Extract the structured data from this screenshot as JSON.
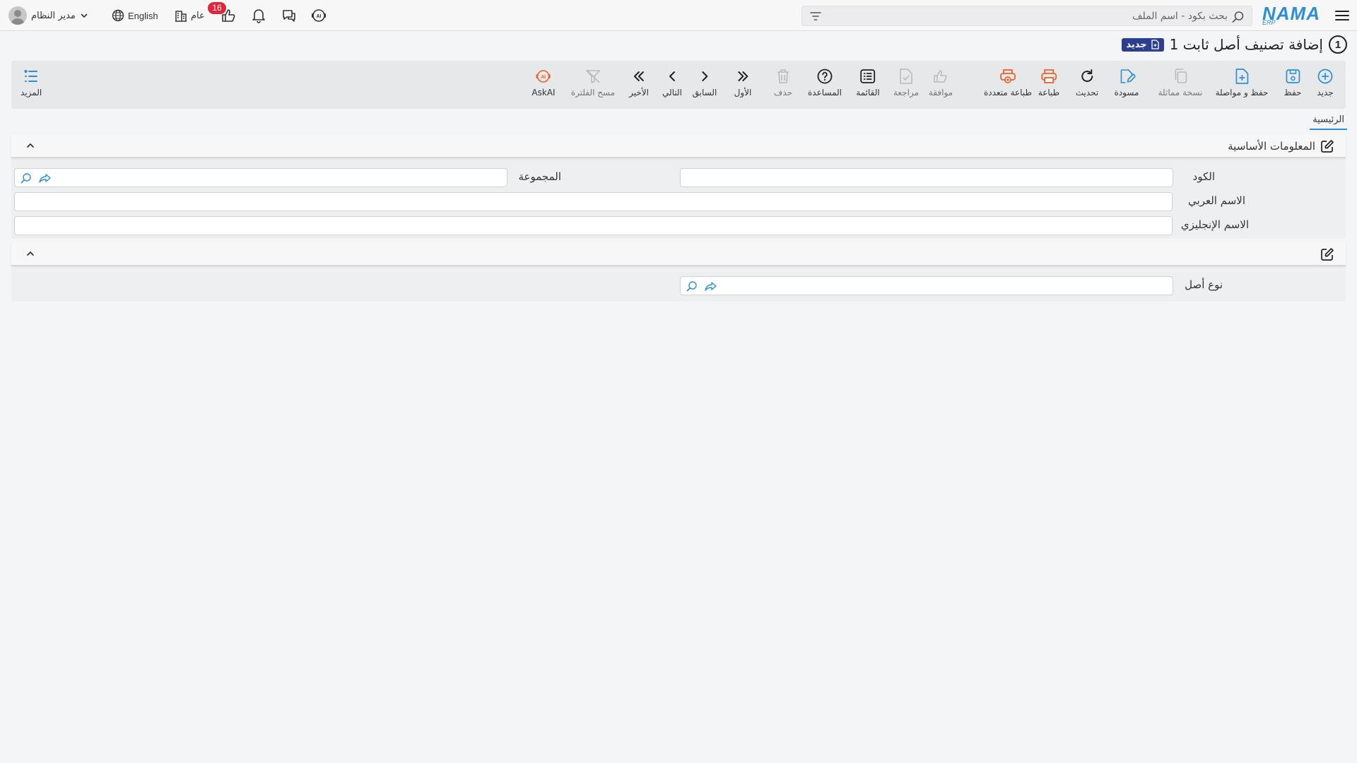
{
  "app": {
    "logo_text": "NAMA",
    "logo_sub": "ERP"
  },
  "header": {
    "search_placeholder": "بحث بكود - اسم الملف",
    "user_name": "مدير النظام",
    "language": "English",
    "company": "عام",
    "likes_count": "16"
  },
  "page": {
    "number": "1",
    "title": "إضافة تصنيف أصل ثابت 1",
    "badge": "جديد"
  },
  "toolbar": {
    "new": "جديد",
    "save": "حفظ",
    "save_continue": "حفظ و مواصلة",
    "duplicate": "نسخة مماثلة",
    "draft": "مسودة",
    "refresh": "تحديث",
    "print": "طباعة",
    "multi_print": "طباعة متعددة",
    "approve": "موافقة",
    "review": "مراجعة",
    "list": "القائمة",
    "help": "المساعدة",
    "delete": "حذف",
    "first": "الأول",
    "previous": "السابق",
    "next": "التالي",
    "last": "الأخير",
    "clear_filter": "مسح الفلترة",
    "ask_ai": "AskAI",
    "more": "المزيد"
  },
  "tabs": {
    "main": "الرئيسية"
  },
  "section_basic": {
    "title": "المعلومات الأساسية",
    "code_label": "الكود",
    "code_value": "",
    "group_label": "المجموعة",
    "group_value": "",
    "arabic_name_label": "الاسم العربي",
    "arabic_name_value": "",
    "english_name_label": "الاسم الإنجليزي",
    "english_name_value": ""
  },
  "section_extra": {
    "asset_type_label": "نوع أصل",
    "asset_type_value": ""
  },
  "colors": {
    "accent": "#2b8ed6",
    "badge_red": "#e0263a",
    "title_badge": "#2c3e8f",
    "print_orange": "#e8612c"
  }
}
